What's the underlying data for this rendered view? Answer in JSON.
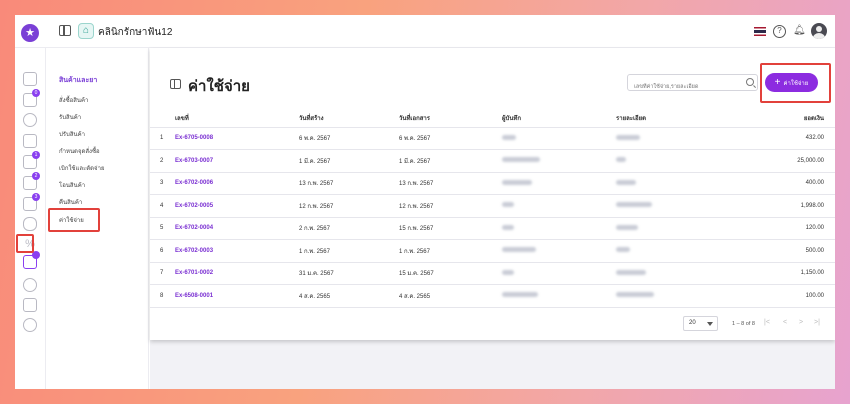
{
  "header": {
    "clinic_name": "คลินิกรักษาฟัน12",
    "logo_icon": "star-logo-icon",
    "icons": [
      "thai-flag-icon",
      "help-icon",
      "bell-icon",
      "user-avatar-icon"
    ]
  },
  "rail": {
    "items": [
      {
        "icon": "home-icon",
        "badge": ""
      },
      {
        "icon": "clipboard-icon",
        "badge": "0"
      },
      {
        "icon": "user-icon",
        "badge": ""
      },
      {
        "icon": "document-icon",
        "badge": ""
      },
      {
        "icon": "building-icon",
        "badge": "1"
      },
      {
        "icon": "chart-icon",
        "badge": "2"
      },
      {
        "icon": "stethoscope-icon",
        "badge": "3"
      },
      {
        "icon": "tooth-icon",
        "badge": ""
      },
      {
        "icon": "percent-icon",
        "badge": ""
      },
      {
        "icon": "inventory-icon",
        "badge": ""
      },
      {
        "icon": "info-icon",
        "badge": ""
      },
      {
        "icon": "report-icon",
        "badge": ""
      },
      {
        "icon": "settings-icon",
        "badge": ""
      }
    ]
  },
  "submenu": {
    "title": "สินค้าและยา",
    "items": [
      "สั่งซื้อสินค้า",
      "รับสินค้า",
      "ปรับสินค้า",
      "กำหนดจุดสั่งซื้อ",
      "เบิกใช้และตัดจ่าย",
      "โอนสินค้า",
      "คืนสินค้า",
      "ค่าใช้จ่าย"
    ]
  },
  "main": {
    "title": "ค่าใช้จ่าย",
    "search_placeholder": "เลขที่ค่าใช้จ่าย,รายละเอียด",
    "add_button_label": "ค่าใช้จ่าย",
    "columns": [
      "",
      "เลขที่",
      "วันที่สร้าง",
      "วันที่เอกสาร",
      "ผู้บันทึก",
      "รายละเอียด",
      "ยอดเงิน"
    ],
    "rows": [
      {
        "idx": "1",
        "doc": "Ex-6705-0008",
        "created": "6 พ.ค. 2567",
        "doc_date": "6 พ.ค. 2567",
        "amount": "432.00"
      },
      {
        "idx": "2",
        "doc": "Ex-6703-0007",
        "created": "1 มี.ค. 2567",
        "doc_date": "1 มี.ค. 2567",
        "amount": "25,000.00"
      },
      {
        "idx": "3",
        "doc": "Ex-6702-0006",
        "created": "13 ก.พ. 2567",
        "doc_date": "13 ก.พ. 2567",
        "amount": "400.00"
      },
      {
        "idx": "4",
        "doc": "Ex-6702-0005",
        "created": "12 ก.พ. 2567",
        "doc_date": "12 ก.พ. 2567",
        "amount": "1,998.00"
      },
      {
        "idx": "5",
        "doc": "Ex-6702-0004",
        "created": "2 ก.พ. 2567",
        "doc_date": "15 ก.พ. 2567",
        "amount": "120.00"
      },
      {
        "idx": "6",
        "doc": "Ex-6702-0003",
        "created": "1 ก.พ. 2567",
        "doc_date": "1 ก.พ. 2567",
        "amount": "500.00"
      },
      {
        "idx": "7",
        "doc": "Ex-6701-0002",
        "created": "31 ม.ค. 2567",
        "doc_date": "15 ม.ค. 2567",
        "amount": "1,150.00"
      },
      {
        "idx": "8",
        "doc": "Ex-6508-0001",
        "created": "4 ส.ค. 2565",
        "doc_date": "4 ส.ค. 2565",
        "amount": "100.00"
      }
    ],
    "pagination": {
      "page_size": "20",
      "range": "1 – 8 of 8"
    }
  },
  "colors": {
    "accent": "#8c2ce0",
    "doc_link": "#7a2fd2",
    "highlight_box": "#e2413b"
  }
}
